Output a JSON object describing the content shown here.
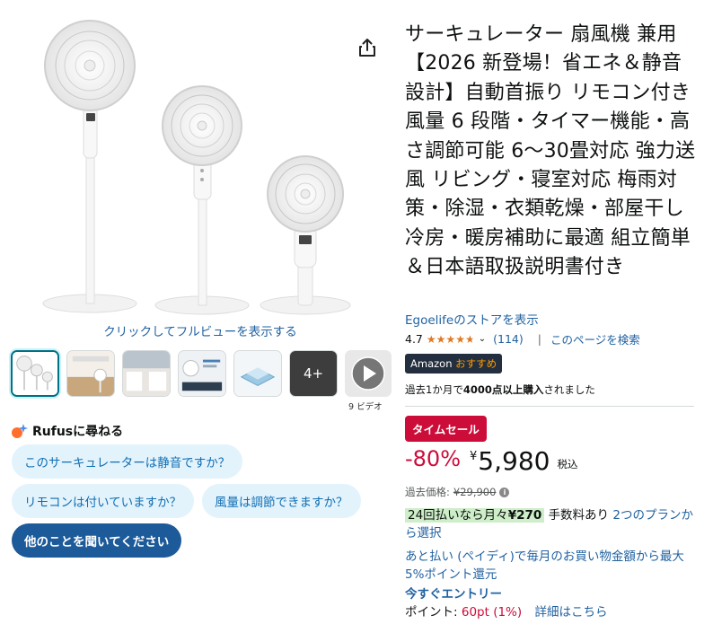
{
  "product": {
    "title": "サーキュレーター 扇風機 兼用【2026 新登場！省エネ＆静音設計】自動首振り リモコン付き 風量 6 段階・タイマー機能・高さ調節可能 6～30畳対応 強力送風 リビング・寝室対応 梅雨対策・除湿・衣類乾燥・部屋干し 冷房・暖房補助に最適 組立簡単＆日本語取扱説明書付き",
    "store_link": "Egoelifeのストアを表示",
    "rating_value": "4.7",
    "rating_stars": 4.7,
    "rating_count": "(114)",
    "rating_separator": "|",
    "search_page": "このページを検索",
    "badge_prefix": "Amazon",
    "badge_suffix": "おすすめ",
    "purchased_prefix": "過去1か月で",
    "purchased_bold": "4000点以上購入",
    "purchased_suffix": "されました"
  },
  "gallery": {
    "fullview_link": "クリックしてフルビューを表示する",
    "more_label": "4+",
    "video_count": "9 ビデオ"
  },
  "rufus": {
    "title": "Rufusに尋ねる",
    "questions": [
      "このサーキュレーターは静音ですか？",
      "リモコンは付いていますか？",
      "風量は調節できますか？"
    ],
    "ask_button": "他のことを聞いてください"
  },
  "pricing": {
    "deal_label": "タイムセール",
    "discount": "-80%",
    "currency": "¥",
    "price": "5,980",
    "tax_label": "税込",
    "past_price_label": "過去価格:",
    "past_price_value": "¥29,900",
    "installment_prefix": "24回払いなら月々",
    "installment_amount": "¥270",
    "installment_fee": "手数料あり",
    "installment_plans": "2つのプランから選択",
    "paidy_text": "あと払い (ペイディ)で毎月のお買い物金額から最大5%ポイント還元",
    "entry_link": "今すぐエントリー",
    "points_label": "ポイント:",
    "points_value": "60pt",
    "points_pct": "(1%)",
    "points_detail": "詳細はこちら"
  },
  "colors": {
    "link": "#2162a1",
    "deal": "#cc0c39",
    "star": "#de7921",
    "rufus_bg": "#e3f3fc",
    "rufus_ask": "#1d5a99",
    "installment_highlight": "#cdeec8"
  },
  "icons": {
    "share": "share-icon",
    "info": "info-icon",
    "rufus": "rufus-sparkle-icon",
    "chevron": "chevron-down-icon",
    "play": "play-icon"
  }
}
